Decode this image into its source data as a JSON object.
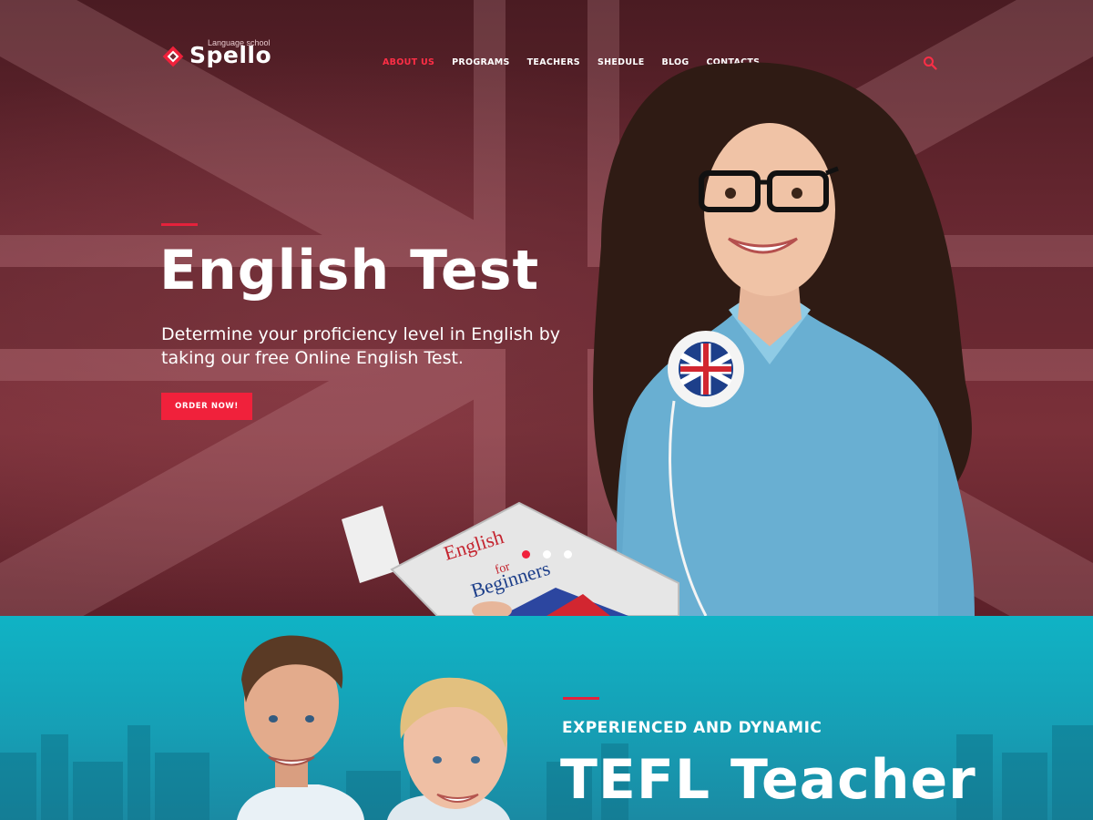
{
  "brand": {
    "tagline": "Language school",
    "name": "Spello"
  },
  "nav": {
    "items": [
      {
        "label": "ABOUT US",
        "active": true
      },
      {
        "label": "PROGRAMS",
        "active": false
      },
      {
        "label": "TEACHERS",
        "active": false
      },
      {
        "label": "SHEDULE",
        "active": false
      },
      {
        "label": "BLOG",
        "active": false
      },
      {
        "label": "CONTACTS",
        "active": false
      }
    ],
    "search_icon": "search-icon"
  },
  "hero": {
    "title": "English Test",
    "description": "Determine your proficiency level in English by taking our free Online English Test.",
    "cta_label": "ORDER NOW!",
    "book_title": [
      "English",
      "for",
      "Beginners"
    ],
    "slides": {
      "count": 3,
      "active_index": 0
    }
  },
  "teachers_section": {
    "subtitle": "EXPERIENCED AND DYNAMIC",
    "title": "TEFL Teacher"
  },
  "colors": {
    "accent": "#f0213b",
    "hero_bg": "#6e2a34",
    "section_bg": "#169fb5",
    "text": "#ffffff"
  }
}
